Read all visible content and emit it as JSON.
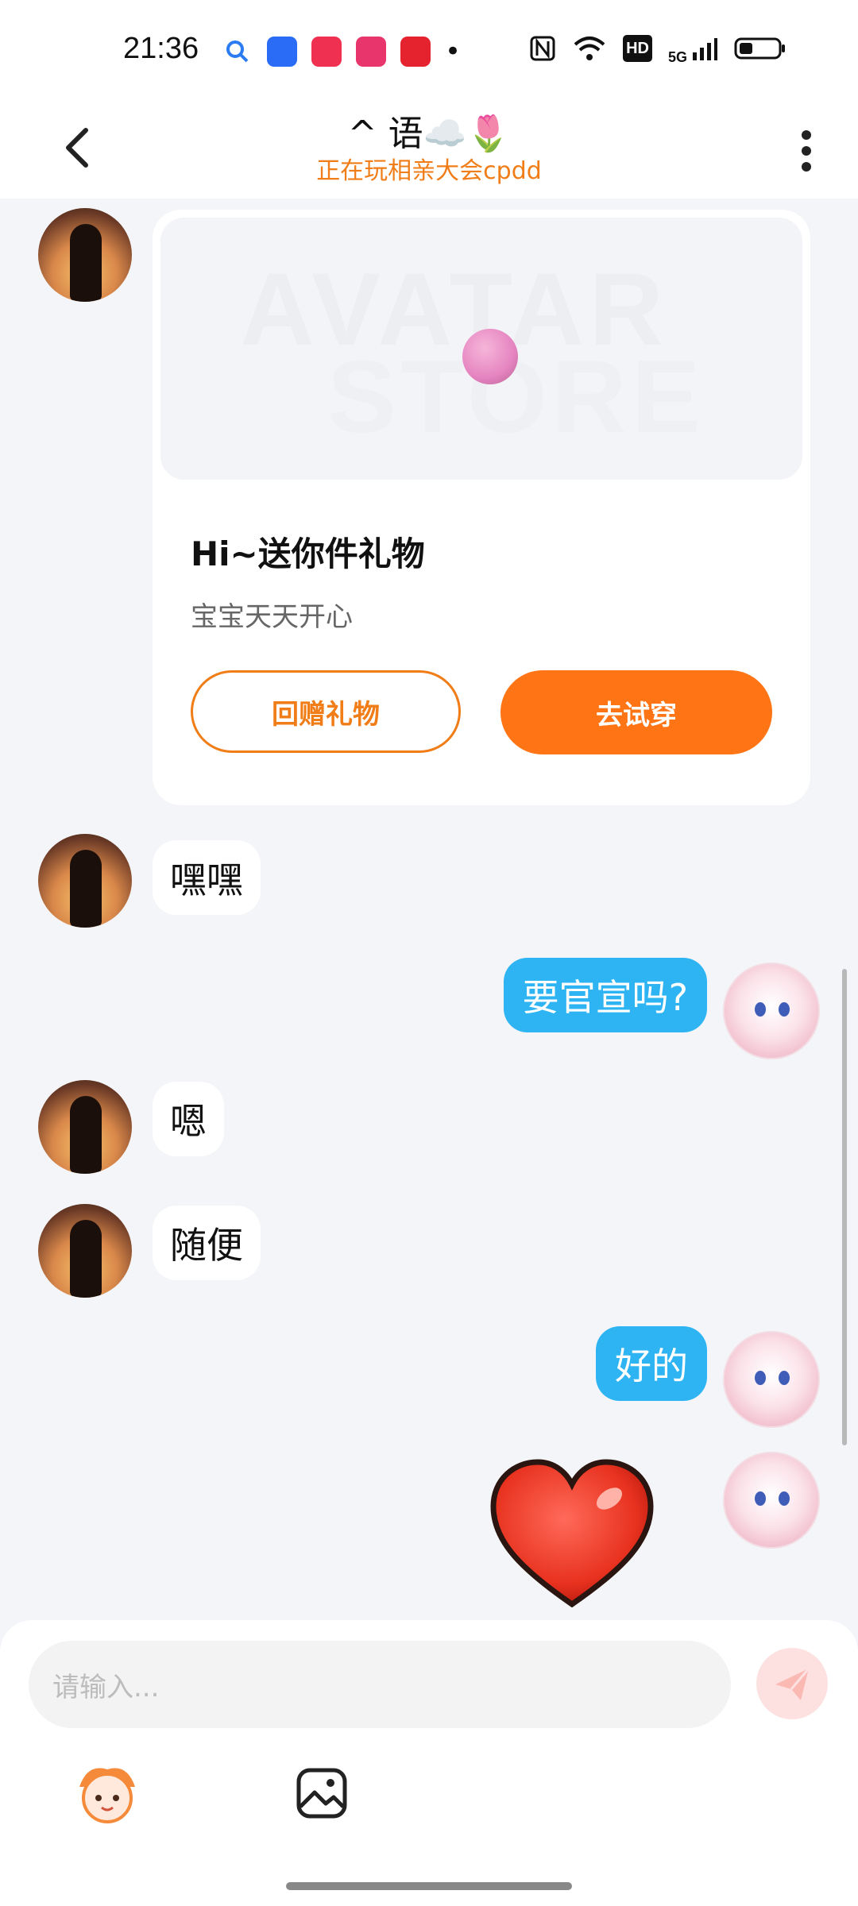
{
  "status_bar": {
    "time": "21:36",
    "app_icons": [
      "search-app-icon",
      "baidu-netdisk-icon",
      "music-app-icon",
      "pinduoduo-icon",
      "taobao-icon"
    ],
    "dot": "•",
    "network": "5G",
    "hd": "HD"
  },
  "header": {
    "title": "^ 语☁️🌷",
    "subtitle": "正在玩相亲大会cpdd"
  },
  "gift_card": {
    "watermark_line1": "AVATAR",
    "watermark_line2": "STORE",
    "title": "Hi~送你件礼物",
    "description": "宝宝天天开心",
    "reply_button": "回赠礼物",
    "try_button": "去试穿"
  },
  "messages": [
    {
      "side": "left",
      "text": "嘿嘿"
    },
    {
      "side": "right",
      "text": "要官宣吗?"
    },
    {
      "side": "left",
      "text": "嗯"
    },
    {
      "side": "left",
      "text": "随便"
    },
    {
      "side": "right",
      "text": "好的"
    },
    {
      "side": "right",
      "sticker": "heart-sticker"
    }
  ],
  "composer": {
    "placeholder": "请输入..."
  },
  "colors": {
    "accent": "#ff7414",
    "subtitle": "#f07d17",
    "bubble_right": "#2fb4f3",
    "background": "#f4f5f8"
  }
}
